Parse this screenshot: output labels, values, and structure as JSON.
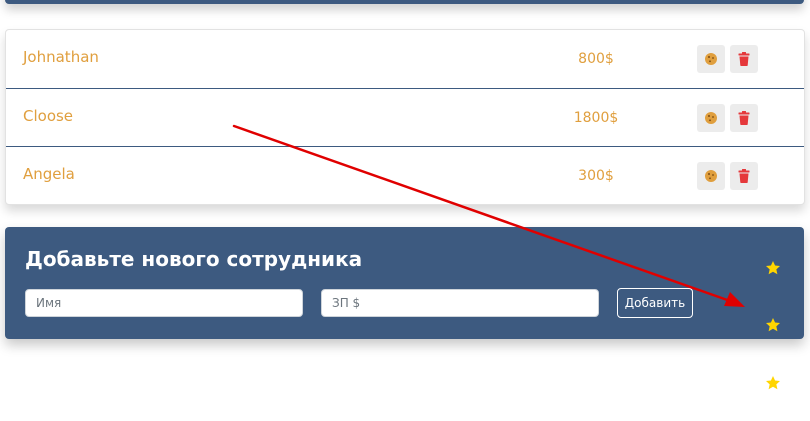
{
  "employees": [
    {
      "name": "Johnathan",
      "salary": "800$"
    },
    {
      "name": "Cloose",
      "salary": "1800$"
    },
    {
      "name": "Angela",
      "salary": "300$"
    }
  ],
  "icons": {
    "increase": "cookie-icon",
    "delete": "trash-icon",
    "starred": "star-icon"
  },
  "add_form": {
    "title": "Добавьте нового сотрудника",
    "name_placeholder": "Имя",
    "salary_placeholder": "ЗП $",
    "submit_label": "Добавить"
  },
  "colors": {
    "panel": "#3d5a80",
    "accent_text": "#e09f3e",
    "delete_icon": "#e5383b",
    "star": "#ffd500",
    "annotation_arrow": "#e00000"
  }
}
